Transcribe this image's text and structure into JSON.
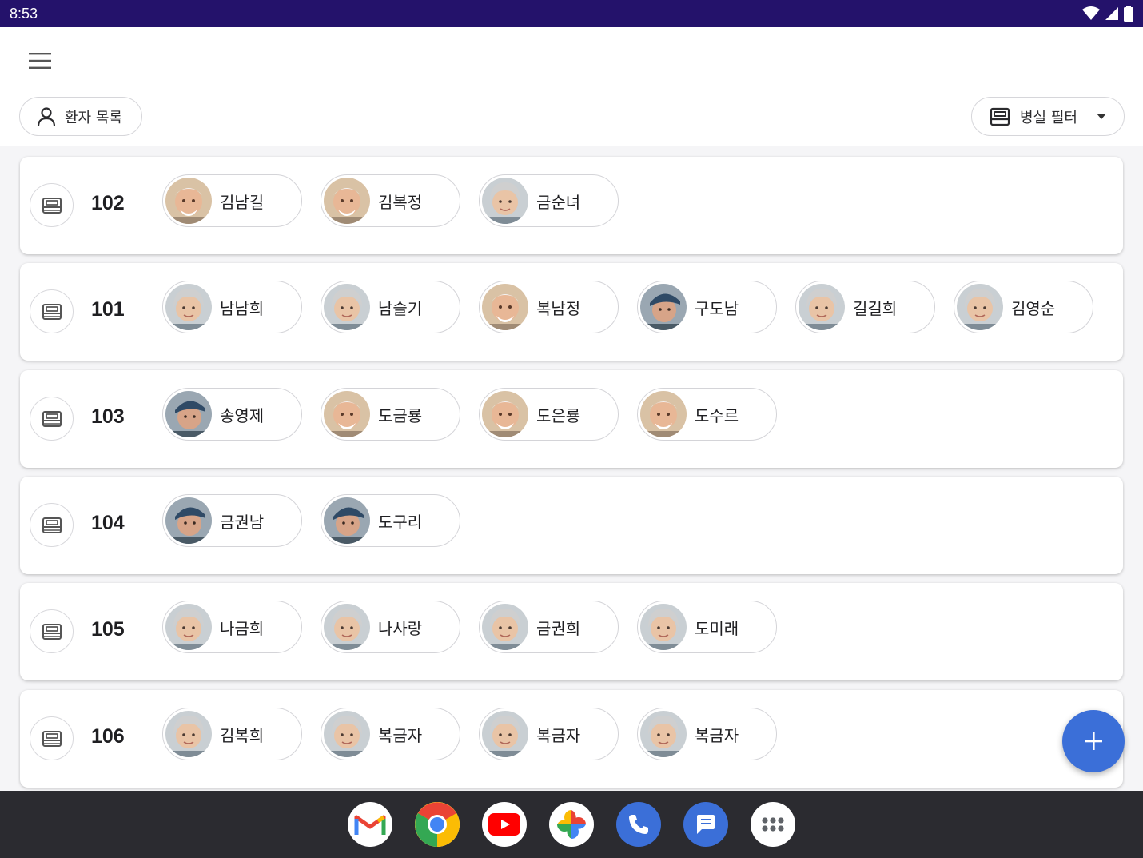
{
  "status_bar": {
    "time": "8:53"
  },
  "toolbar": {
    "patient_list_label": "환자 목록",
    "room_filter_label": "병실 필터"
  },
  "rooms": [
    {
      "number": "102",
      "patients": [
        {
          "name": "김남길",
          "avatar": "elderly-man"
        },
        {
          "name": "김복정",
          "avatar": "elderly-man"
        },
        {
          "name": "금순녀",
          "avatar": "elderly-woman"
        }
      ]
    },
    {
      "number": "101",
      "patients": [
        {
          "name": "남남희",
          "avatar": "elderly-woman"
        },
        {
          "name": "남슬기",
          "avatar": "elderly-woman"
        },
        {
          "name": "복남정",
          "avatar": "elderly-man"
        },
        {
          "name": "구도남",
          "avatar": "elderly-man-cap"
        },
        {
          "name": "길길희",
          "avatar": "elderly-woman"
        },
        {
          "name": "김영순",
          "avatar": "elderly-woman"
        }
      ]
    },
    {
      "number": "103",
      "patients": [
        {
          "name": "송영제",
          "avatar": "elderly-man-cap"
        },
        {
          "name": "도금룡",
          "avatar": "elderly-man"
        },
        {
          "name": "도은룡",
          "avatar": "elderly-man"
        },
        {
          "name": "도수르",
          "avatar": "elderly-man"
        }
      ]
    },
    {
      "number": "104",
      "patients": [
        {
          "name": "금권남",
          "avatar": "elderly-man-cap"
        },
        {
          "name": "도구리",
          "avatar": "elderly-man-cap"
        }
      ]
    },
    {
      "number": "105",
      "patients": [
        {
          "name": "나금희",
          "avatar": "elderly-woman"
        },
        {
          "name": "나사랑",
          "avatar": "elderly-woman"
        },
        {
          "name": "금권희",
          "avatar": "elderly-woman"
        },
        {
          "name": "도미래",
          "avatar": "elderly-woman"
        }
      ]
    },
    {
      "number": "106",
      "patients": [
        {
          "name": "김복희",
          "avatar": "elderly-woman"
        },
        {
          "name": "복금자",
          "avatar": "elderly-woman"
        },
        {
          "name": "복금자",
          "avatar": "elderly-woman"
        },
        {
          "name": "복금자",
          "avatar": "elderly-woman"
        }
      ]
    }
  ],
  "fab": {
    "icon": "plus-icon"
  },
  "dock": [
    "gmail-icon",
    "chrome-icon",
    "youtube-icon",
    "photos-icon",
    "phone-icon",
    "messages-icon",
    "app-drawer-icon"
  ],
  "colors": {
    "status_bar": "#24126b",
    "fab": "#3b6fd8",
    "nav_bar": "#2b2b30"
  }
}
